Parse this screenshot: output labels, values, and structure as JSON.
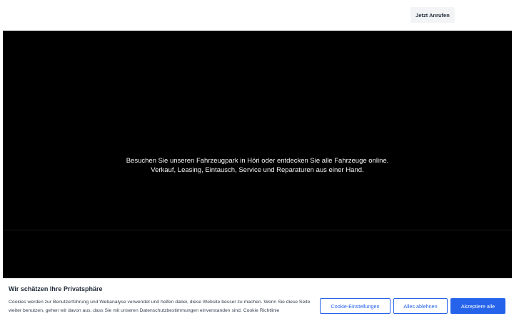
{
  "header": {
    "call_button_label": "Jetzt Anrufen"
  },
  "hero": {
    "line1": "Besuchen Sie unseren Fahrzeugpark in Höri oder entdecken Sie alle Fahrzeuge online.",
    "line2": "Verkauf, Leasing, Eintausch, Service und Reparaturen aus einer Hand."
  },
  "cookie": {
    "title": "Wir schätzen Ihre Privatsphäre",
    "text": "Cookies werden zur Benutzerführung und Webanalyse verwendet und helfen dabei, diese Website besser zu machen. Wenn Sie diese Seite weiter benutzen, gehen wir davon aus, dass Sie mit unseren Datenschutzbestimmungen einverstanden sind.",
    "policy_link": "Cookie Richtlinie",
    "settings_label": "Cookie-Einstellungen",
    "reject_label": "Alles ablehnen",
    "accept_label": "Akzeptiere alle"
  },
  "colors": {
    "accent": "#2563eb",
    "hero_background": "#000000",
    "call_button_background": "#f3f4f6"
  }
}
